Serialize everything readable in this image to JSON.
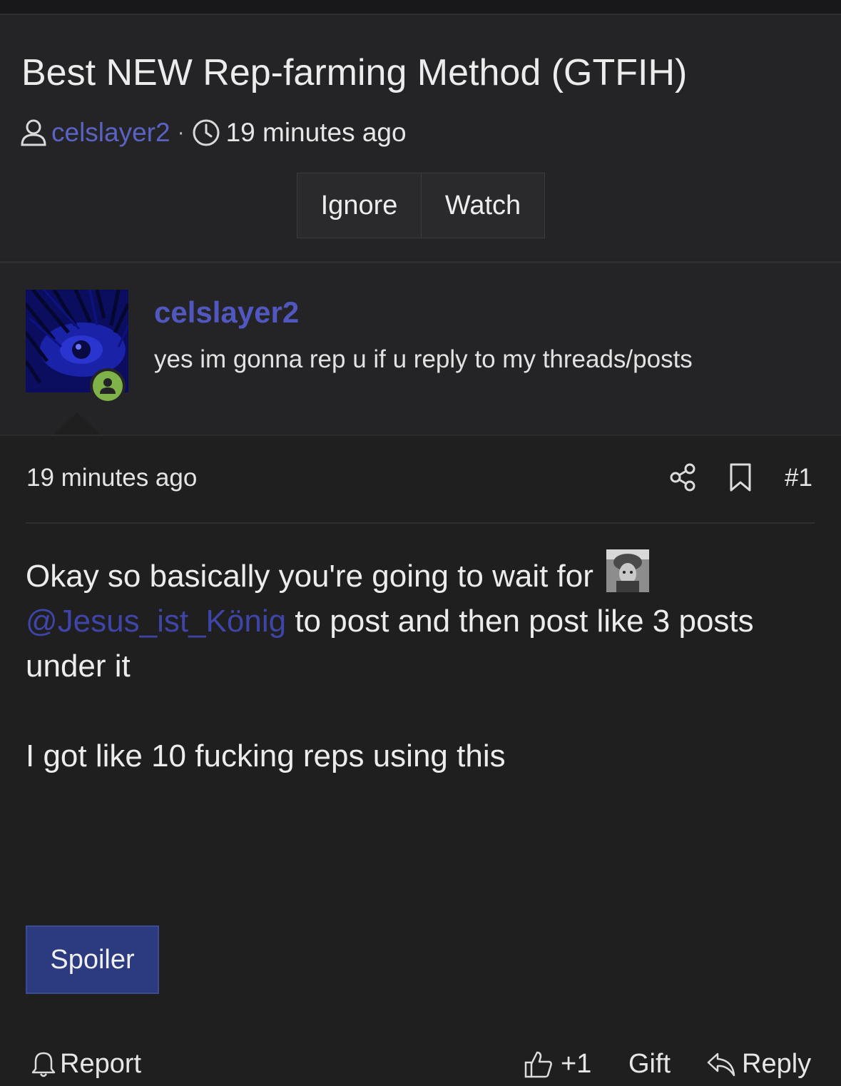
{
  "thread": {
    "title": "Best NEW Rep-farming Method (GTFIH)",
    "author": "celslayer2",
    "separator": "·",
    "time": "19 minutes ago",
    "ignore_label": "Ignore",
    "watch_label": "Watch"
  },
  "user": {
    "name": "celslayer2",
    "bio": "yes im gonna rep u if u reply to my threads/posts",
    "status": "online"
  },
  "post": {
    "time": "19 minutes ago",
    "number": "#1",
    "text_before": "Okay so basically you're going to wait for",
    "mention": "@Jesus_ist_König",
    "text_after": "to post and then post like 3 posts under it",
    "paragraph2": "I got like 10 fucking reps using this",
    "spoiler_label": "Spoiler"
  },
  "footer": {
    "report_label": "Report",
    "like_label": "+1",
    "gift_label": "Gift",
    "reply_label": "Reply"
  },
  "colors": {
    "background": "#1f1f20",
    "panel": "#242426",
    "link": "#5a63c4",
    "spoiler": "#2c3b80",
    "online": "#7fb34a"
  }
}
